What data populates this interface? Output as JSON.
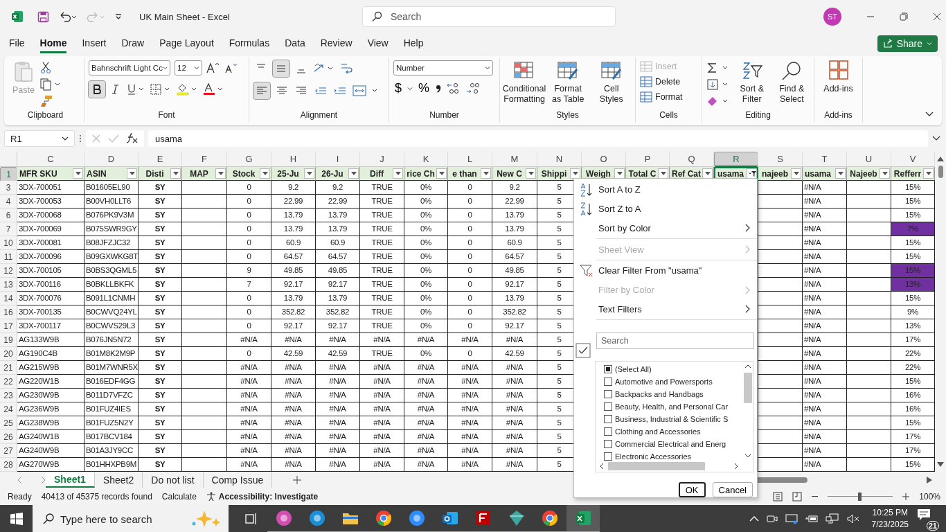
{
  "window": {
    "title": "UK Main Sheet  -  Excel",
    "search_placeholder": "Search",
    "avatar": "ST"
  },
  "menu_tabs": [
    {
      "label": "File",
      "selected": false
    },
    {
      "label": "Home",
      "selected": true
    },
    {
      "label": "Insert",
      "selected": false
    },
    {
      "label": "Draw",
      "selected": false
    },
    {
      "label": "Page Layout",
      "selected": false
    },
    {
      "label": "Formulas",
      "selected": false
    },
    {
      "label": "Data",
      "selected": false
    },
    {
      "label": "Review",
      "selected": false
    },
    {
      "label": "View",
      "selected": false
    },
    {
      "label": "Help",
      "selected": false
    }
  ],
  "share": "Share",
  "ribbon": {
    "clipboard": {
      "label": "Clipboard",
      "paste": "Paste",
      "paste_disabled": true
    },
    "font": {
      "label": "Font",
      "name": "Bahnschrift Light Cc",
      "size": "12",
      "bold": true
    },
    "alignment": {
      "label": "Alignment",
      "middle_align": true,
      "left_align": true
    },
    "number": {
      "label": "Number",
      "format": "Number",
      "currency": "$",
      "percent": "%"
    },
    "styles": {
      "label": "Styles",
      "buttons": [
        "Conditional Formatting",
        "Format as Table",
        "Cell Styles"
      ]
    },
    "cells": {
      "label": "Cells",
      "buttons": [
        {
          "label": "Insert",
          "disabled": true
        },
        {
          "label": "Delete",
          "disabled": false
        },
        {
          "label": "Format",
          "disabled": false
        }
      ]
    },
    "editing": {
      "label": "Editing",
      "buttons": [
        "Sort & Filter",
        "Find & Select"
      ]
    },
    "addins": {
      "label": "Add-ins",
      "button": "Add-ins"
    }
  },
  "formula_bar": {
    "name_box": "R1",
    "formula": "usama"
  },
  "header_row": "1",
  "columns": [
    {
      "letter": "C",
      "header": "MFR SKU",
      "selected": false,
      "filtered": false
    },
    {
      "letter": "D",
      "header": "ASIN",
      "selected": false,
      "filtered": false
    },
    {
      "letter": "E",
      "header": "Disti",
      "selected": false,
      "filtered": false
    },
    {
      "letter": "F",
      "header": "MAP",
      "selected": false,
      "filtered": false
    },
    {
      "letter": "G",
      "header": "Stock",
      "selected": false,
      "filtered": false
    },
    {
      "letter": "H",
      "header": "25-Ju",
      "selected": false,
      "filtered": false
    },
    {
      "letter": "I",
      "header": "26-Ju",
      "selected": false,
      "filtered": false
    },
    {
      "letter": "J",
      "header": "Diff",
      "selected": false,
      "filtered": false
    },
    {
      "letter": "K",
      "header": "rice Ch",
      "selected": false,
      "filtered": false
    },
    {
      "letter": "L",
      "header": "e than",
      "selected": false,
      "filtered": false
    },
    {
      "letter": "M",
      "header": "New C",
      "selected": false,
      "filtered": false
    },
    {
      "letter": "N",
      "header": "Shippi",
      "selected": false,
      "filtered": false
    },
    {
      "letter": "O",
      "header": "Weigh",
      "selected": false,
      "filtered": false
    },
    {
      "letter": "P",
      "header": "Total C",
      "selected": false,
      "filtered": false
    },
    {
      "letter": "Q",
      "header": "Ref Cat",
      "selected": false,
      "filtered": false
    },
    {
      "letter": "R",
      "header": "usama",
      "selected": true,
      "filtered": true
    },
    {
      "letter": "S",
      "header": "najeeb",
      "selected": false,
      "filtered": false
    },
    {
      "letter": "T",
      "header": "usama",
      "selected": false,
      "filtered": false
    },
    {
      "letter": "U",
      "header": "Najeeb",
      "selected": false,
      "filtered": false
    },
    {
      "letter": "V",
      "header": "Refferr",
      "selected": false,
      "filtered": false
    }
  ],
  "rows": [
    {
      "num": "3",
      "highlighted": false,
      "cells": {
        "C": "3DX-700051",
        "D": "B01605EL90",
        "E": "SY",
        "G": "0",
        "H": "9.2",
        "I": "9.2",
        "J": "TRUE",
        "K": "0%",
        "L": "0",
        "M": "9.2",
        "N": "5",
        "T": "#N/A",
        "V": "15%"
      }
    },
    {
      "num": "4",
      "highlighted": false,
      "cells": {
        "C": "3DX-700053",
        "D": "B00VH0LLT6",
        "E": "SY",
        "G": "0",
        "H": "22.99",
        "I": "22.99",
        "J": "TRUE",
        "K": "0%",
        "L": "0",
        "M": "22.99",
        "N": "5",
        "T": "#N/A",
        "V": "15%"
      }
    },
    {
      "num": "6",
      "highlighted": false,
      "cells": {
        "C": "3DX-700068",
        "D": "B076PK9V3M",
        "E": "SY",
        "G": "0",
        "H": "13.79",
        "I": "13.79",
        "J": "TRUE",
        "K": "0%",
        "L": "0",
        "M": "13.79",
        "N": "5",
        "T": "#N/A",
        "V": "15%"
      }
    },
    {
      "num": "7",
      "highlighted": true,
      "cells": {
        "C": "3DX-700069",
        "D": "B075SWR9GY",
        "E": "SY",
        "G": "0",
        "H": "13.79",
        "I": "13.79",
        "J": "TRUE",
        "K": "0%",
        "L": "0",
        "M": "13.79",
        "N": "5",
        "T": "#N/A",
        "V": "7%"
      }
    },
    {
      "num": "10",
      "highlighted": false,
      "cells": {
        "C": "3DX-700081",
        "D": "B08JFZJC32",
        "E": "SY",
        "G": "0",
        "H": "60.9",
        "I": "60.9",
        "J": "TRUE",
        "K": "0%",
        "L": "0",
        "M": "60.9",
        "N": "5",
        "T": "#N/A",
        "V": "15%"
      }
    },
    {
      "num": "11",
      "highlighted": false,
      "cells": {
        "C": "3DX-700096",
        "D": "B09GXWKG8T",
        "E": "SY",
        "G": "0",
        "H": "64.57",
        "I": "64.57",
        "J": "TRUE",
        "K": "0%",
        "L": "0",
        "M": "64.57",
        "N": "5",
        "T": "#N/A",
        "V": "15%"
      }
    },
    {
      "num": "12",
      "highlighted": true,
      "cells": {
        "C": "3DX-700105",
        "D": "B0BS3QGML5",
        "E": "SY",
        "G": "9",
        "H": "49.85",
        "I": "49.85",
        "J": "TRUE",
        "K": "0%",
        "L": "0",
        "M": "49.85",
        "N": "5",
        "T": "#N/A",
        "V": "15%"
      }
    },
    {
      "num": "13",
      "highlighted": true,
      "cells": {
        "C": "3DX-700116",
        "D": "B0BKLLBKFK",
        "E": "SY",
        "G": "7",
        "H": "92.17",
        "I": "92.17",
        "J": "TRUE",
        "K": "0%",
        "L": "0",
        "M": "92.17",
        "N": "5",
        "T": "#N/A",
        "V": "13%"
      }
    },
    {
      "num": "14",
      "highlighted": false,
      "cells": {
        "C": "3DX-700076",
        "D": "B091L1CNMH",
        "E": "SY",
        "G": "0",
        "H": "13.79",
        "I": "13.79",
        "J": "TRUE",
        "K": "0%",
        "L": "0",
        "M": "13.79",
        "N": "5",
        "T": "#N/A",
        "V": "15%"
      }
    },
    {
      "num": "16",
      "highlighted": false,
      "cells": {
        "C": "3DX-700135",
        "D": "B0CWVQ24YL",
        "E": "SY",
        "G": "0",
        "H": "352.82",
        "I": "352.82",
        "J": "TRUE",
        "K": "0%",
        "L": "0",
        "M": "352.82",
        "N": "5",
        "T": "#N/A",
        "V": "9%"
      }
    },
    {
      "num": "17",
      "highlighted": false,
      "cells": {
        "C": "3DX-700117",
        "D": "B0CWVS29L3",
        "E": "SY",
        "G": "0",
        "H": "92.17",
        "I": "92.17",
        "J": "TRUE",
        "K": "0%",
        "L": "0",
        "M": "92.17",
        "N": "5",
        "T": "#N/A",
        "V": "13%"
      }
    },
    {
      "num": "19",
      "highlighted": false,
      "cells": {
        "C": "AG133W9B",
        "D": "B076JN5N72",
        "E": "SY",
        "G": "#N/A",
        "H": "#N/A",
        "I": "#N/A",
        "J": "#N/A",
        "K": "#N/A",
        "L": "#N/A",
        "M": "#N/A",
        "N": "5",
        "T": "#N/A",
        "V": "17%"
      }
    },
    {
      "num": "20",
      "highlighted": false,
      "cells": {
        "C": "AG190C4B",
        "D": "B01M8K2M9P",
        "E": "SY",
        "G": "0",
        "H": "42.59",
        "I": "42.59",
        "J": "TRUE",
        "K": "0%",
        "L": "0",
        "M": "42.59",
        "N": "5",
        "T": "#N/A",
        "V": "22%"
      }
    },
    {
      "num": "21",
      "highlighted": false,
      "cells": {
        "C": "AG215W9B",
        "D": "B01M7WNR5X",
        "E": "SY",
        "G": "#N/A",
        "H": "#N/A",
        "I": "#N/A",
        "J": "#N/A",
        "K": "#N/A",
        "L": "#N/A",
        "M": "#N/A",
        "N": "5",
        "T": "#N/A",
        "V": "22%"
      }
    },
    {
      "num": "22",
      "highlighted": false,
      "cells": {
        "C": "AG220W1B",
        "D": "B016EDF4GG",
        "E": "SY",
        "G": "#N/A",
        "H": "#N/A",
        "I": "#N/A",
        "J": "#N/A",
        "K": "#N/A",
        "L": "#N/A",
        "M": "#N/A",
        "N": "5",
        "T": "#N/A",
        "V": "15%"
      }
    },
    {
      "num": "23",
      "highlighted": false,
      "cells": {
        "C": "AG230W9B",
        "D": "B011D7VFZC",
        "E": "SY",
        "G": "#N/A",
        "H": "#N/A",
        "I": "#N/A",
        "J": "#N/A",
        "K": "#N/A",
        "L": "#N/A",
        "M": "#N/A",
        "N": "5",
        "T": "#N/A",
        "V": "16%"
      }
    },
    {
      "num": "24",
      "highlighted": false,
      "cells": {
        "C": "AG236W9B",
        "D": "B01FUZ4IES",
        "E": "SY",
        "G": "#N/A",
        "H": "#N/A",
        "I": "#N/A",
        "J": "#N/A",
        "K": "#N/A",
        "L": "#N/A",
        "M": "#N/A",
        "N": "5",
        "T": "#N/A",
        "V": "16%"
      }
    },
    {
      "num": "25",
      "highlighted": false,
      "cells": {
        "C": "AG238W9B",
        "D": "B01FUZ5N2Y",
        "E": "SY",
        "G": "#N/A",
        "H": "#N/A",
        "I": "#N/A",
        "J": "#N/A",
        "K": "#N/A",
        "L": "#N/A",
        "M": "#N/A",
        "N": "5",
        "T": "#N/A",
        "V": "15%"
      }
    },
    {
      "num": "26",
      "highlighted": false,
      "cells": {
        "C": "AG240W1B",
        "D": "B017BCV184",
        "E": "SY",
        "G": "#N/A",
        "H": "#N/A",
        "I": "#N/A",
        "J": "#N/A",
        "K": "#N/A",
        "L": "#N/A",
        "M": "#N/A",
        "N": "5",
        "T": "#N/A",
        "V": "17%"
      }
    },
    {
      "num": "27",
      "highlighted": false,
      "cells": {
        "C": "AG240W9B",
        "D": "B01A3JY9CC",
        "E": "SY",
        "G": "#N/A",
        "H": "#N/A",
        "I": "#N/A",
        "J": "#N/A",
        "K": "#N/A",
        "L": "#N/A",
        "M": "#N/A",
        "N": "5",
        "T": "#N/A",
        "V": "17%"
      }
    },
    {
      "num": "28",
      "highlighted": false,
      "cells": {
        "C": "AG270W9B",
        "D": "B01HHXPB9M",
        "E": "SY",
        "G": "#N/A",
        "H": "#N/A",
        "I": "#N/A",
        "J": "#N/A",
        "K": "#N/A",
        "L": "#N/A",
        "M": "#N/A",
        "N": "5",
        "T": "#N/A",
        "V": "15%"
      }
    }
  ],
  "filter_menu": {
    "items": [
      {
        "kind": "sort-az",
        "label": "Sort A to Z",
        "disabled": false,
        "separator_after": false
      },
      {
        "kind": "sort-za",
        "label": "Sort Z to A",
        "disabled": false,
        "separator_after": false
      },
      {
        "kind": "submenu",
        "label": "Sort by Color",
        "disabled": false,
        "separator_after": true
      },
      {
        "kind": "submenu",
        "label": "Sheet View",
        "disabled": true,
        "separator_after": true
      },
      {
        "kind": "clear-filter",
        "label": "Clear Filter From \"usama\"",
        "disabled": false,
        "separator_after": false
      },
      {
        "kind": "submenu",
        "label": "Filter by Color",
        "disabled": true,
        "separator_after": false
      },
      {
        "kind": "submenu",
        "label": "Text Filters",
        "disabled": false,
        "separator_after": true
      }
    ],
    "search_placeholder": "Search",
    "values": [
      {
        "label": "(Select All)",
        "checked": false,
        "partial": true
      },
      {
        "label": "Automotive and Powersports",
        "checked": false,
        "partial": false
      },
      {
        "label": "Backpacks and Handbags",
        "checked": false,
        "partial": false
      },
      {
        "label": "Beauty, Health, and Personal Car",
        "checked": false,
        "partial": false
      },
      {
        "label": "Business, Industrial & Scientific S",
        "checked": false,
        "partial": false
      },
      {
        "label": "Clothing and Accessories",
        "checked": false,
        "partial": false
      },
      {
        "label": "Commercial Electrical and Energ",
        "checked": false,
        "partial": false
      },
      {
        "label": "Electronic Accessories",
        "checked": false,
        "partial": false
      }
    ],
    "ok": "OK",
    "cancel": "Cancel"
  },
  "sheet_tabs": [
    {
      "label": "Sheet1",
      "selected": true
    },
    {
      "label": "Sheet2",
      "selected": false
    },
    {
      "label": "Do not list",
      "selected": false
    },
    {
      "label": "Comp Issue",
      "selected": false
    }
  ],
  "status_bar": {
    "mode": "Ready",
    "records": "40413 of 45375 records found",
    "calculate": "Calculate",
    "accessibility": "Accessibility: Investigate",
    "zoom": "100%",
    "zoom_slider": {
      "level": 0.5
    }
  },
  "taskbar": {
    "search_placeholder": "Type here to search",
    "time": "10:25 PM",
    "date": "7/23/2025",
    "notifications": "21",
    "apps": [
      {
        "kind": "office",
        "active": false
      },
      {
        "kind": "edge",
        "active": false
      },
      {
        "kind": "folder",
        "active": false
      },
      {
        "kind": "chrome",
        "active": false
      },
      {
        "kind": "zoom",
        "active": false
      },
      {
        "kind": "outlook",
        "active": false
      },
      {
        "kind": "filezilla",
        "active": false
      },
      {
        "kind": "gem",
        "active": false
      },
      {
        "kind": "chrome",
        "active": false
      },
      {
        "kind": "excel",
        "active": true
      }
    ]
  }
}
